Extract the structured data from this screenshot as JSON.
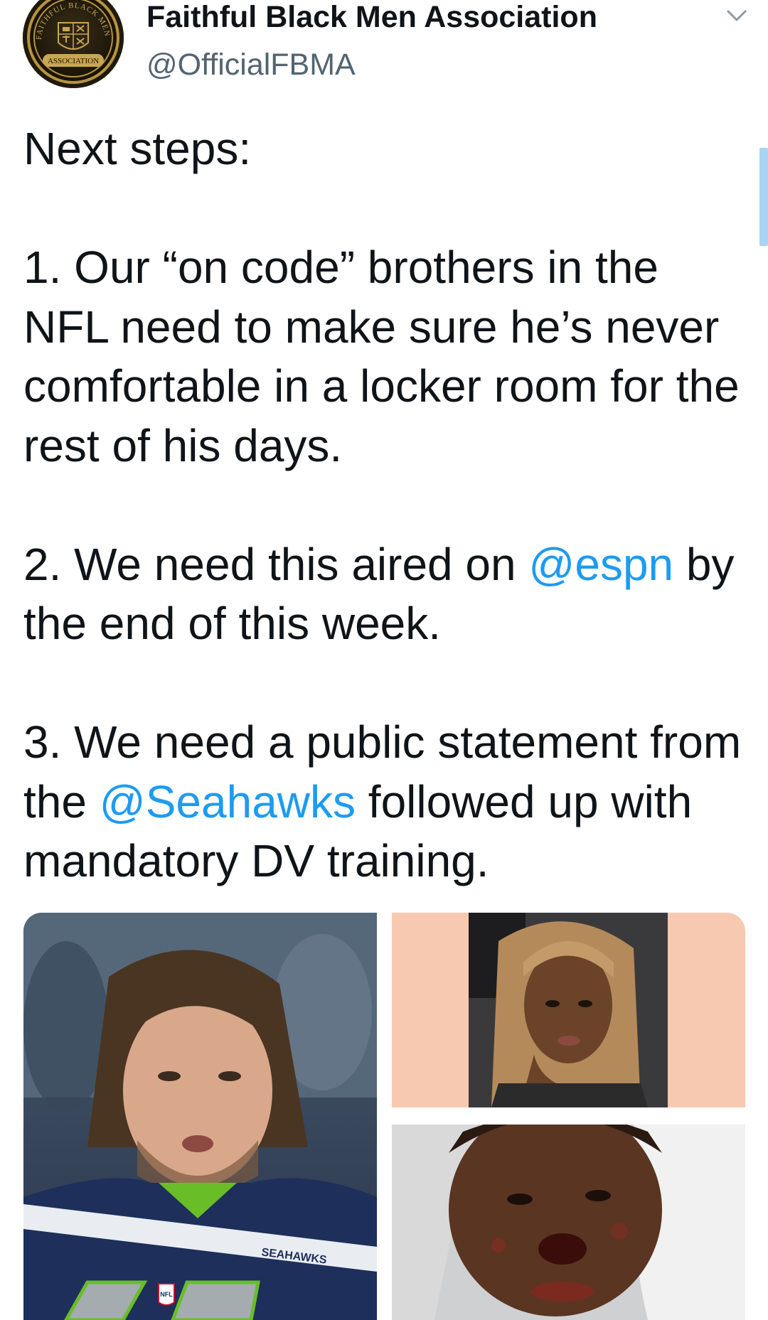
{
  "account": {
    "display_name": "Faithful Black Men Association",
    "handle": "@OfficialFBMA",
    "avatar_text_top": "FAITHFUL BLACK MEN",
    "avatar_text_bottom": "ASSOCIATION"
  },
  "tweet": {
    "intro": "Next steps:",
    "step1": "1. Our “on code” brothers in the NFL need to make sure he’s never comfortable in a locker room for the rest of his days.",
    "step2_before": "2. We need this aired on ",
    "step2_mention": "@espn",
    "step2_after": " by the end of this week.",
    "step3_before": "3. We need a public statement from the ",
    "step3_mention": "@Seahawks",
    "step3_after": " followed up with mandatory DV training."
  },
  "media": {
    "jersey_text": "SEAHAWKS",
    "nfl_badge": "NFL"
  },
  "colors": {
    "mention": "#1d9bf0",
    "handle": "#536471",
    "scrollbar": "#a9d4f2"
  }
}
